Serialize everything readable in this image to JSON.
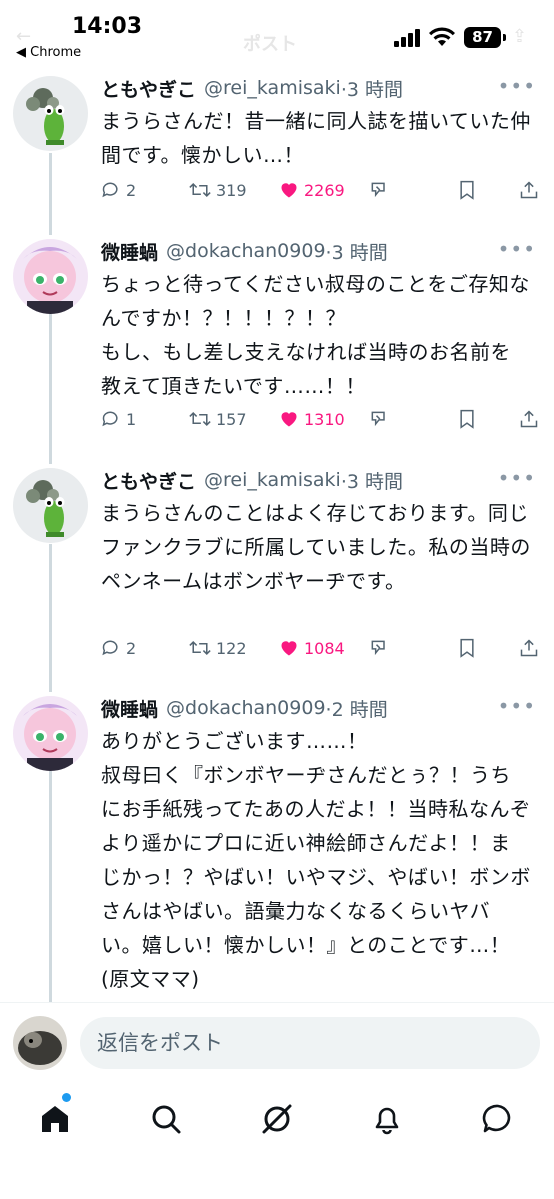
{
  "status_bar": {
    "time": "14:03",
    "back_app": "◀ Chrome",
    "faded_title": "ポスト",
    "battery": "87"
  },
  "tweets": [
    {
      "name": "ともやぎこ",
      "handle": "@rei_kamisaki",
      "time": "·3 時間",
      "text": "まうらさんだ！昔一緒に同人誌を描いていた仲間です。懐かしい…！",
      "replies": "2",
      "reposts": "319",
      "likes": "2269"
    },
    {
      "name": "微睡蝸",
      "handle": "@dokachan0909",
      "time": "·3 時間",
      "text": "ちょっと待ってください叔母のことをご存知なんですか！？！！！？！？\nもし、もし差し支えなければ当時のお名前を教えて頂きたいです……！！",
      "replies": "1",
      "reposts": "157",
      "likes": "1310"
    },
    {
      "name": "ともやぎこ",
      "handle": "@rei_kamisaki",
      "time": "·3 時間",
      "text": "まうらさんのことはよく存じております。同じファンクラブに所属していました。私の当時のペンネームはボンボヤーヂです。",
      "replies": "2",
      "reposts": "122",
      "likes": "1084"
    },
    {
      "name": "微睡蝸",
      "handle": "@dokachan0909",
      "time": "·2 時間",
      "text": "ありがとうございます……！\n叔母曰く『ボンボヤーヂさんだとぅ？！うちにお手紙残ってたあの人だよ！！当時私なんぞより遥かにプロに近い神絵師さんだよ！！まじかっ！？やばい！いやマジ、やばい！ボンボさんはやばい。語彙力なくなるくらいヤバい。嬉しい！懐かしい！』とのことです…！(原文ママ)"
    }
  ],
  "reply_bar": {
    "placeholder": "返信をポスト"
  },
  "tab_bar": {
    "items": [
      "home-icon",
      "search-icon",
      "grok-icon",
      "notifications-icon",
      "messages-icon"
    ]
  },
  "colors": {
    "like": "#f91880",
    "accent": "#1d9bf0",
    "secondary_text": "#536471",
    "thread_line": "#cfd9de"
  }
}
